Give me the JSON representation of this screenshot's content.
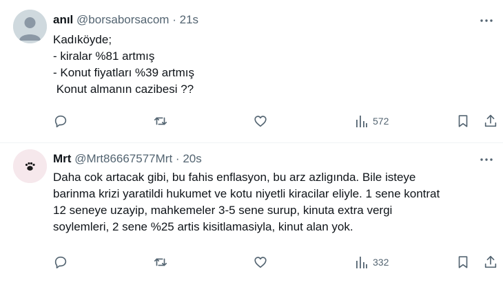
{
  "tweets": [
    {
      "name": "anıl",
      "handle": "@borsaborsacom",
      "separator": "·",
      "time": "21s",
      "avatar_icon": "default-profile-icon",
      "lines": [
        "Kadıköyde;",
        "- kiralar %81 artmış",
        "- Konut fiyatları %39 artmış",
        " Konut almanın cazibesi ??"
      ],
      "views": "572"
    },
    {
      "name": "Mrt",
      "handle": "@Mrt86667577Mrt",
      "separator": "·",
      "time": "20s",
      "avatar_icon": "paw-icon",
      "lines": [
        "Daha cok artacak gibi, bu fahis enflasyon, bu arz azligında. Bile isteye",
        "barinma krizi yaratildi hukumet ve kotu niyetli kiracilar eliyle. 1 sene kontrat",
        "12 seneye uzayip, mahkemeler 3-5 sene surup, kinuta extra vergi",
        "soylemleri, 2 sene %25 artis kisitlamasiyla, kinut alan yok."
      ],
      "views": "332"
    }
  ],
  "colors": {
    "text": "#0f1419",
    "secondary": "#536471",
    "divider": "#eff3f4"
  }
}
